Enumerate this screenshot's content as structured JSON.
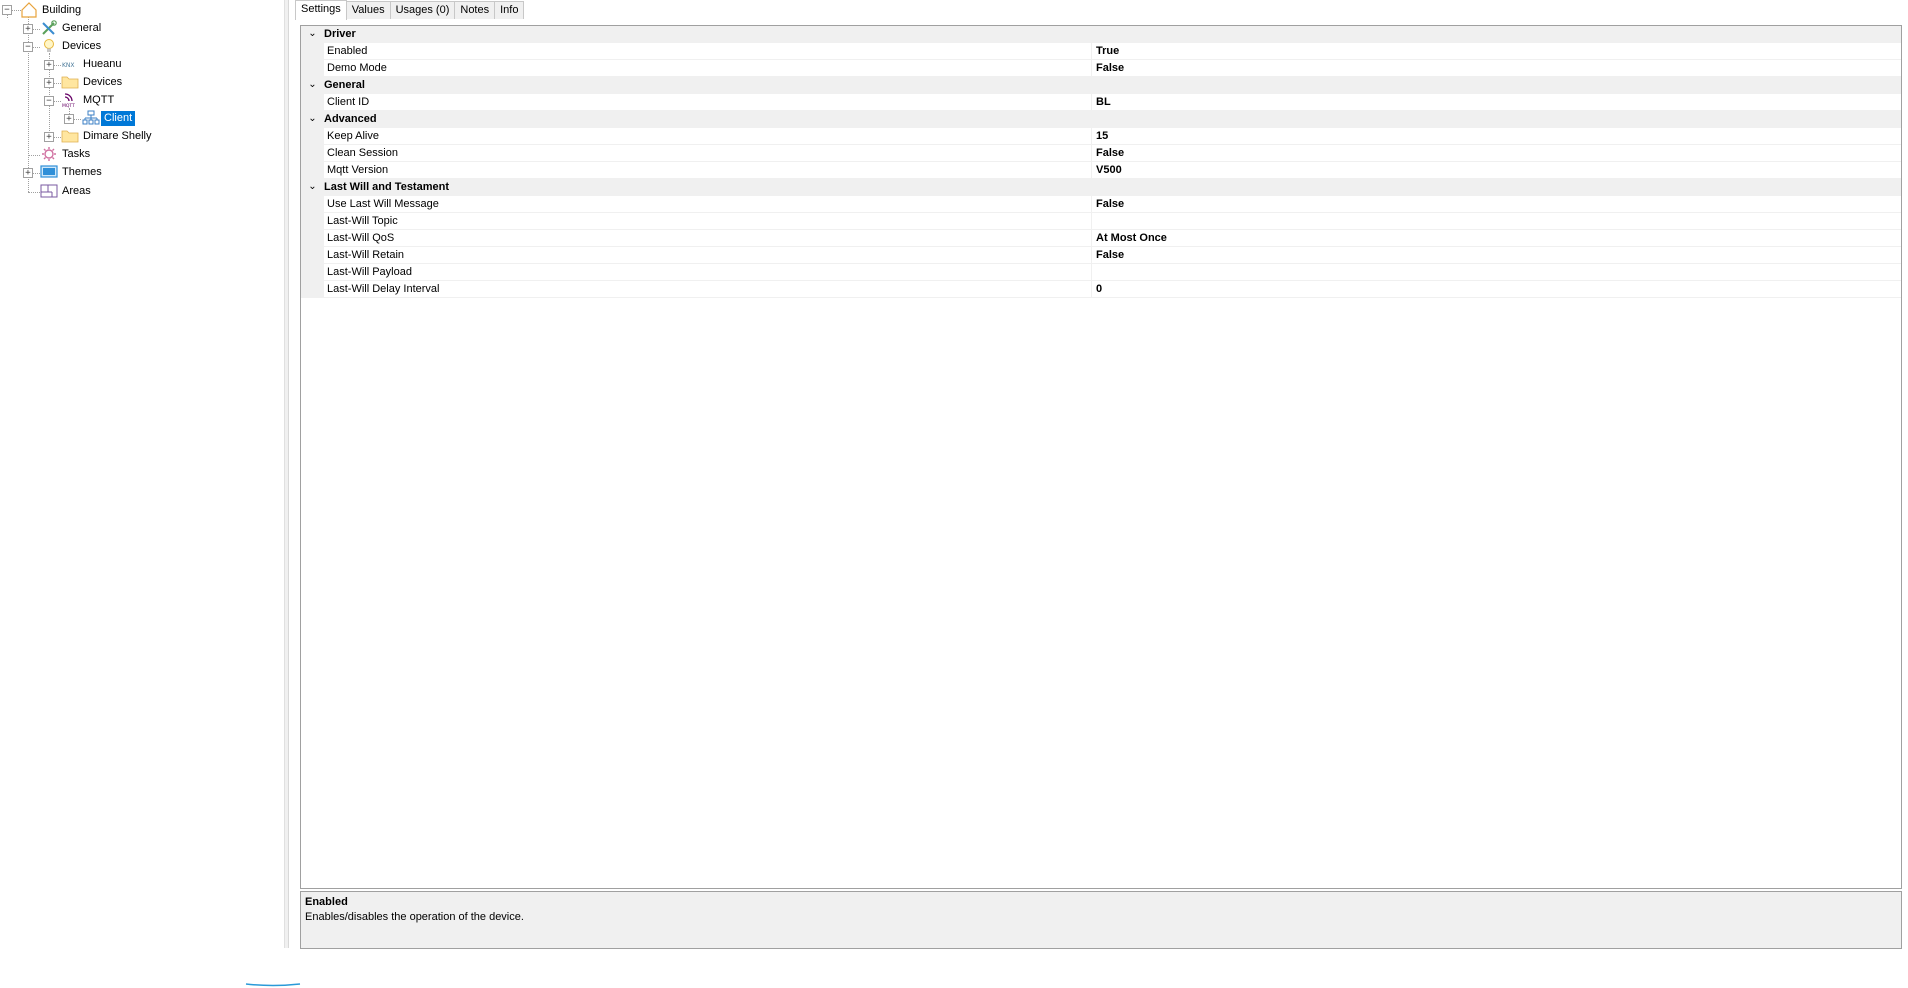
{
  "tree": {
    "root": {
      "label": "Building",
      "icon": "house-icon"
    },
    "items": [
      {
        "label": "General",
        "icon": "tools-icon",
        "expander": "+"
      },
      {
        "label": "Devices",
        "icon": "lightbulb-icon",
        "expander": "-"
      },
      {
        "label": "Hueanu",
        "icon": "knx-icon",
        "expander": "+"
      },
      {
        "label": "Devices",
        "icon": "folder-icon",
        "expander": "+"
      },
      {
        "label": "MQTT",
        "icon": "mqtt-icon",
        "expander": "-"
      },
      {
        "label": "Client",
        "icon": "network-icon",
        "expander": "+",
        "selected": true
      },
      {
        "label": "Dimare Shelly",
        "icon": "folder-icon",
        "expander": "+"
      },
      {
        "label": "Tasks",
        "icon": "gear-icon"
      },
      {
        "label": "Themes",
        "icon": "monitor-icon",
        "expander": "+"
      },
      {
        "label": "Areas",
        "icon": "floorplan-icon"
      }
    ]
  },
  "tabs": [
    "Settings",
    "Values",
    "Usages (0)",
    "Notes",
    "Info"
  ],
  "active_tab": "Settings",
  "properties": {
    "driver": {
      "title": "Driver",
      "rows": [
        {
          "name": "Enabled",
          "value": "True"
        },
        {
          "name": "Demo Mode",
          "value": "False"
        }
      ]
    },
    "general": {
      "title": "General",
      "rows": [
        {
          "name": "Client ID",
          "value": "BL"
        }
      ]
    },
    "advanced": {
      "title": "Advanced",
      "rows": [
        {
          "name": "Keep Alive",
          "value": "15"
        },
        {
          "name": "Clean Session",
          "value": "False"
        },
        {
          "name": "Mqtt Version",
          "value": "V500"
        }
      ]
    },
    "lastwill": {
      "title": "Last Will and Testament",
      "rows": [
        {
          "name": "Use Last Will Message",
          "value": "False"
        },
        {
          "name": "Last-Will Topic",
          "value": ""
        },
        {
          "name": "Last-Will QoS",
          "value": "At Most Once"
        },
        {
          "name": "Last-Will Retain",
          "value": "False"
        },
        {
          "name": "Last-Will Payload",
          "value": ""
        },
        {
          "name": "Last-Will Delay Interval",
          "value": "0"
        }
      ]
    }
  },
  "help": {
    "title": "Enabled",
    "description": "Enables/disables the operation of the device."
  },
  "colors": {
    "selection": "#0078d7",
    "grid_gutter": "#f0f0f0",
    "border": "#a0a0a0"
  }
}
